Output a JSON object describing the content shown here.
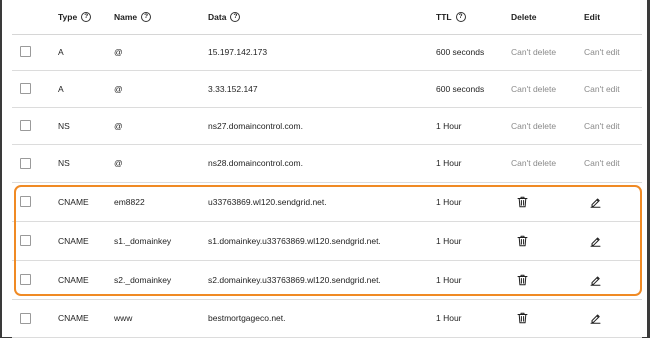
{
  "headers": {
    "type": "Type",
    "name": "Name",
    "data": "Data",
    "ttl": "TTL",
    "delete": "Delete",
    "edit": "Edit",
    "help_glyph": "?"
  },
  "records": [
    {
      "type": "A",
      "name": "@",
      "data": "15.197.142.173",
      "ttl": "600 seconds",
      "delete": "Can't delete",
      "edit": "Can't edit",
      "editable": false
    },
    {
      "type": "A",
      "name": "@",
      "data": "3.33.152.147",
      "ttl": "600 seconds",
      "delete": "Can't delete",
      "edit": "Can't edit",
      "editable": false
    },
    {
      "type": "NS",
      "name": "@",
      "data": "ns27.domaincontrol.com.",
      "ttl": "1 Hour",
      "delete": "Can't delete",
      "edit": "Can't edit",
      "editable": false
    },
    {
      "type": "NS",
      "name": "@",
      "data": "ns28.domaincontrol.com.",
      "ttl": "1 Hour",
      "delete": "Can't delete",
      "edit": "Can't edit",
      "editable": false
    },
    {
      "type": "CNAME",
      "name": "em8822",
      "data": "u33763869.wl120.sendgrid.net.",
      "ttl": "1 Hour",
      "delete_icon": "trash-icon",
      "edit_icon": "pencil-icon",
      "editable": true
    },
    {
      "type": "CNAME",
      "name": "s1._domainkey",
      "data": "s1.domainkey.u33763869.wl120.sendgrid.net.",
      "ttl": "1 Hour",
      "delete_icon": "trash-icon",
      "edit_icon": "pencil-icon",
      "editable": true
    },
    {
      "type": "CNAME",
      "name": "s2._domainkey",
      "data": "s2.domainkey.u33763869.wl120.sendgrid.net.",
      "ttl": "1 Hour",
      "delete_icon": "trash-icon",
      "edit_icon": "pencil-icon",
      "editable": true
    },
    {
      "type": "CNAME",
      "name": "www",
      "data": "bestmortgageco.net.",
      "ttl": "1 Hour",
      "delete_icon": "trash-icon",
      "edit_icon": "pencil-icon",
      "editable": true
    }
  ],
  "colors": {
    "highlight": "#f08a24",
    "muted_text": "#8a8a8a",
    "text": "#1f1f1f"
  }
}
